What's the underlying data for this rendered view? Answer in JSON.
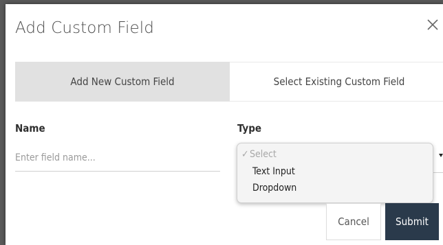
{
  "modal": {
    "title": "Add Custom Field",
    "close_icon": "close-icon"
  },
  "tabs": [
    {
      "label": "Add New Custom Field",
      "active": true
    },
    {
      "label": "Select Existing Custom Field",
      "active": false
    }
  ],
  "form": {
    "name_label": "Name",
    "name_placeholder": "Enter field name...",
    "name_value": "",
    "type_label": "Type",
    "type_selected": "Select",
    "type_options": [
      "Select",
      "Text Input",
      "Dropdown"
    ],
    "check_mark": "✓"
  },
  "buttons": {
    "cancel": "Cancel",
    "submit": "Submit"
  },
  "colors": {
    "submit_bg": "#2a3a4b",
    "active_tab_bg": "#e1e1e1"
  }
}
